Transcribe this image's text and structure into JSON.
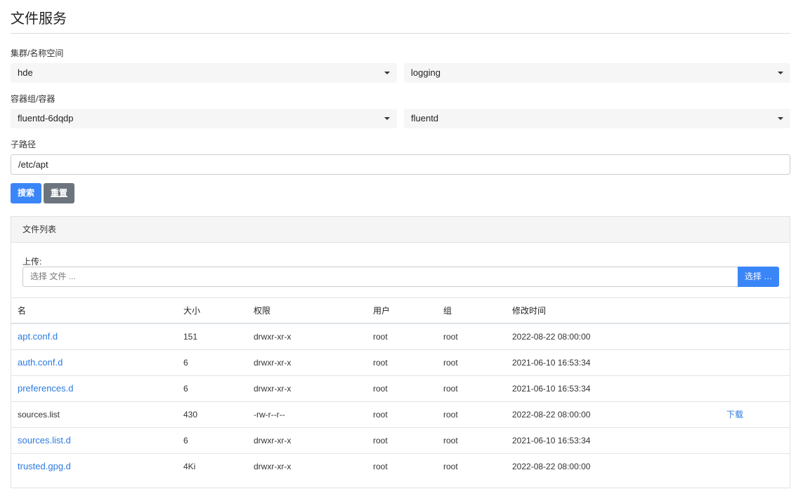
{
  "page": {
    "title": "文件服务"
  },
  "filters": {
    "cluster_namespace_label": "集群/名称空间",
    "cluster": "hde",
    "namespace": "logging",
    "pod_container_label": "容器组/容器",
    "pod": "fluentd-6dqdp",
    "container": "fluentd",
    "subpath_label": "子路径",
    "subpath_value": "/etc/apt",
    "search_label": "搜索",
    "reset_label": "重置"
  },
  "file_list": {
    "header": "文件列表",
    "upload_label": "上传:",
    "upload_placeholder": "选择 文件 ...",
    "upload_button": "选择 …",
    "columns": [
      "名",
      "大小",
      "权限",
      "用户",
      "组",
      "修改时间"
    ],
    "rows": [
      {
        "name": "apt.conf.d",
        "size": "151",
        "perm": "drwxr-xr-x",
        "user": "root",
        "group": "root",
        "mtime": "2022-08-22 08:00:00",
        "is_dir": true,
        "action": ""
      },
      {
        "name": "auth.conf.d",
        "size": "6",
        "perm": "drwxr-xr-x",
        "user": "root",
        "group": "root",
        "mtime": "2021-06-10 16:53:34",
        "is_dir": true,
        "action": ""
      },
      {
        "name": "preferences.d",
        "size": "6",
        "perm": "drwxr-xr-x",
        "user": "root",
        "group": "root",
        "mtime": "2021-06-10 16:53:34",
        "is_dir": true,
        "action": ""
      },
      {
        "name": "sources.list",
        "size": "430",
        "perm": "-rw-r--r--",
        "user": "root",
        "group": "root",
        "mtime": "2022-08-22 08:00:00",
        "is_dir": false,
        "action": "下载"
      },
      {
        "name": "sources.list.d",
        "size": "6",
        "perm": "drwxr-xr-x",
        "user": "root",
        "group": "root",
        "mtime": "2021-06-10 16:53:34",
        "is_dir": true,
        "action": ""
      },
      {
        "name": "trusted.gpg.d",
        "size": "4Ki",
        "perm": "drwxr-xr-x",
        "user": "root",
        "group": "root",
        "mtime": "2022-08-22 08:00:00",
        "is_dir": true,
        "action": ""
      }
    ]
  },
  "colors": {
    "primary": "#3a86f8",
    "secondary": "#6c757d",
    "link": "#2a7ae2"
  }
}
